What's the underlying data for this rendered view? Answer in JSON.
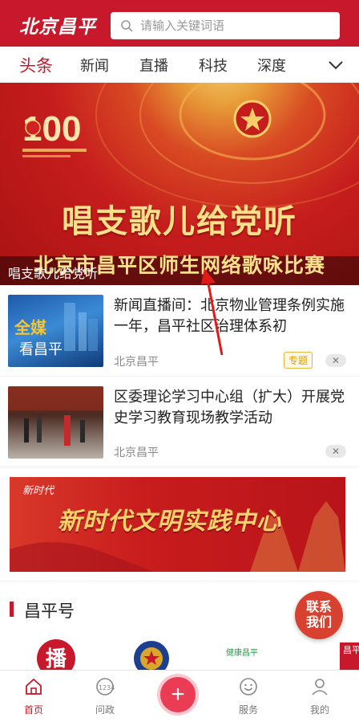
{
  "header": {
    "logo": "北京昌平",
    "search_placeholder": "请输入关键词语"
  },
  "tabs": [
    {
      "label": "头条",
      "active": true
    },
    {
      "label": "新闻",
      "active": false
    },
    {
      "label": "直播",
      "active": false
    },
    {
      "label": "科技",
      "active": false
    },
    {
      "label": "深度",
      "active": false
    }
  ],
  "banner": {
    "main_text": "唱支歌儿给党听",
    "sub_text": "北京市昌平区师生网络歌咏比赛",
    "caption": "唱支歌儿给党听",
    "emblem_number": "100"
  },
  "news": [
    {
      "thumb_text": [
        "全媒",
        "看昌平"
      ],
      "title": "新闻直播间：北京物业管理条例实施一年，昌平社区治理体系初",
      "source": "北京昌平",
      "tag": "专题",
      "close": "✕"
    },
    {
      "title": "区委理论学习中心组（扩大）开展党史学习教育现场教学活动",
      "source": "北京昌平",
      "close": "✕"
    }
  ],
  "civ_banner": {
    "logo": "新时代",
    "text": "新时代文明实践中心"
  },
  "section": {
    "title": "昌平号",
    "contact_button": [
      "联系",
      "我们"
    ]
  },
  "accounts": [
    {
      "glyph": "播"
    },
    {
      "glyph": ""
    },
    {
      "glyph": "健康昌平"
    },
    {
      "glyph": "昌平"
    }
  ],
  "bottom_nav": [
    {
      "label": "首页",
      "icon": "home-icon",
      "active": true
    },
    {
      "label": "问政",
      "icon": "hotline-icon",
      "active": false
    },
    {
      "label": "+",
      "icon": "plus-icon",
      "active": false
    },
    {
      "label": "服务",
      "icon": "smile-icon",
      "active": false
    },
    {
      "label": "我的",
      "icon": "user-icon",
      "active": false
    }
  ],
  "colors": {
    "brand": "#c8182b",
    "tag": "#e0a000",
    "plus": "#ea3d55"
  }
}
